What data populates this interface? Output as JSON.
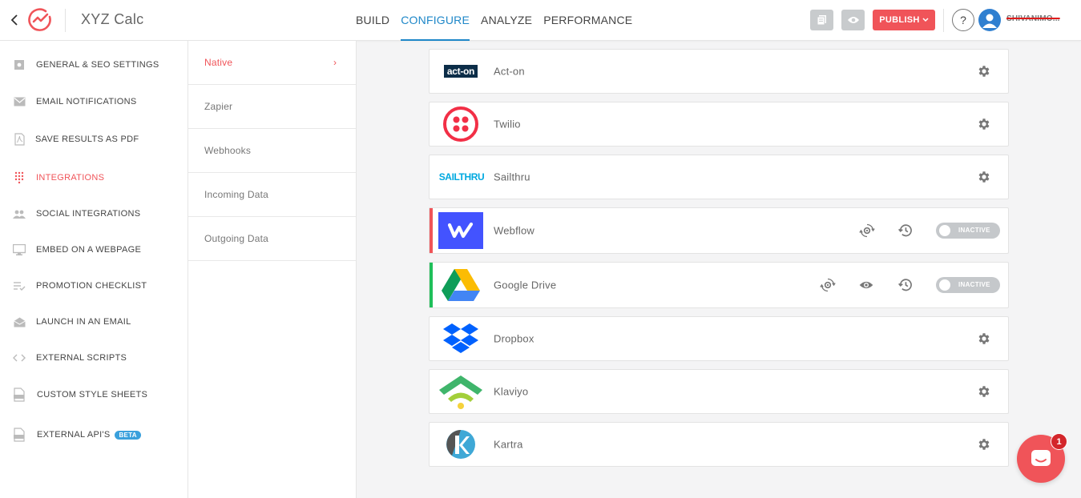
{
  "header": {
    "app_title": "XYZ Calc",
    "nav": [
      {
        "label": "BUILD",
        "active": false
      },
      {
        "label": "CONFIGURE",
        "active": true
      },
      {
        "label": "ANALYZE",
        "active": false
      },
      {
        "label": "PERFORMANCE",
        "active": false
      }
    ],
    "publish_label": "PUBLISH",
    "help_label": "?",
    "username": "SHIVANIMO..."
  },
  "sidebar": {
    "items": [
      {
        "label": "GENERAL & SEO SETTINGS",
        "icon": "settings-square-icon"
      },
      {
        "label": "EMAIL NOTIFICATIONS",
        "icon": "envelope-icon"
      },
      {
        "label": "SAVE RESULTS AS PDF",
        "icon": "pdf-icon"
      },
      {
        "label": "INTEGRATIONS",
        "icon": "dots-grid-icon",
        "active": true
      },
      {
        "label": "SOCIAL INTEGRATIONS",
        "icon": "users-icon"
      },
      {
        "label": "EMBED ON A WEBPAGE",
        "icon": "monitor-icon"
      },
      {
        "label": "PROMOTION CHECKLIST",
        "icon": "checklist-icon"
      },
      {
        "label": "LAUNCH IN AN EMAIL",
        "icon": "open-envelope-icon"
      },
      {
        "label": "EXTERNAL SCRIPTS",
        "icon": "code-icon"
      },
      {
        "label": "CUSTOM STYLE SHEETS",
        "icon": "css-file-icon"
      },
      {
        "label": "EXTERNAL API'S",
        "icon": "api-file-icon",
        "badge": "BETA"
      }
    ]
  },
  "submenu": {
    "items": [
      {
        "label": "Native",
        "active": true
      },
      {
        "label": "Zapier"
      },
      {
        "label": "Webhooks"
      },
      {
        "label": "Incoming Data"
      },
      {
        "label": "Outgoing Data"
      }
    ],
    "chevron": "›"
  },
  "integrations": [
    {
      "name": "Act-on",
      "logo_text": "act-on"
    },
    {
      "name": "Twilio"
    },
    {
      "name": "Sailthru",
      "logo_text": "SAILTHRU"
    },
    {
      "name": "Webflow",
      "status": "INACTIVE",
      "accent": "#f05459"
    },
    {
      "name": "Google Drive",
      "status": "INACTIVE",
      "accent": "#1fbf5a"
    },
    {
      "name": "Dropbox"
    },
    {
      "name": "Klaviyo"
    },
    {
      "name": "Kartra"
    }
  ],
  "chat": {
    "badge": "1"
  },
  "colors": {
    "accent": "#f05459",
    "primary": "#1e87c8",
    "toggle_off": "#c5c8cb"
  }
}
